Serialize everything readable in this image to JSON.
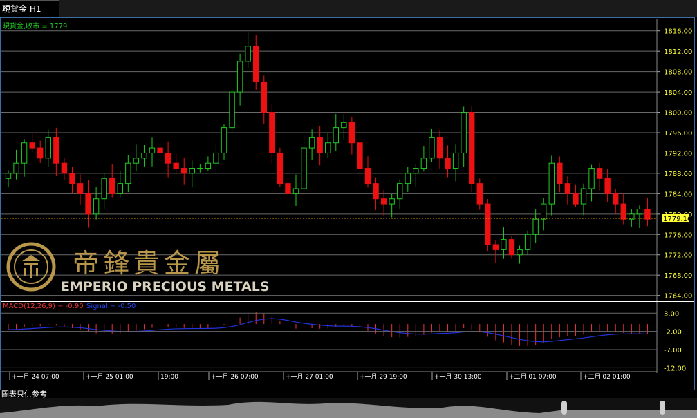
{
  "tab": {
    "title": "現貨金 H1",
    "close": "×"
  },
  "series_label": "現貨金,收市 = 1779",
  "macd_label": "MACD(12,26,9) = -0.90",
  "signal_label": "Signal = -0.50",
  "price_tag": "1779.16",
  "footer_note": "圖表只供參考",
  "watermark": {
    "chinese": "帝鋒貴金屬",
    "english": "EMPERIO PRECIOUS METALS"
  },
  "colors": {
    "up": "#22cc22",
    "down": "#ee1111",
    "axis_text": "#ffff33",
    "signal": "#2222ee",
    "macd": "#ee3333",
    "price_line": "#cc8800"
  },
  "chart_data": {
    "type": "candlestick",
    "title": "現貨金 H1",
    "y_ticks": [
      "1816.00",
      "1812.00",
      "1808.00",
      "1804.00",
      "1800.00",
      "1796.00",
      "1792.00",
      "1788.00",
      "1784.00",
      "1780.00",
      "1776.00",
      "1772.00",
      "1768.00",
      "1764.00"
    ],
    "y_range": [
      1763,
      1818
    ],
    "last_price": 1779.16,
    "x_ticks": [
      "一月 24 07:00",
      "一月 25 01:00",
      "19:00",
      "一月 26 07:00",
      "一月 27 01:00",
      "一月 29 19:00",
      "一月 30 13:00",
      "二月 01 07:00",
      "二月 02 01:00"
    ],
    "macd_ticks": [
      "3.00",
      "-2.00",
      "-7.00",
      "-12.00"
    ],
    "macd_range": [
      -12.5,
      4
    ],
    "close": [
      1788,
      1790,
      1794,
      1793,
      1791,
      1795,
      1790,
      1788,
      1786,
      1784,
      1780,
      1783,
      1787,
      1784,
      1786,
      1790,
      1791,
      1792,
      1793,
      1792,
      1790,
      1789,
      1788,
      1789,
      1789,
      1790,
      1792,
      1797,
      1804,
      1810,
      1813,
      1806,
      1800,
      1792,
      1786,
      1784,
      1785,
      1793,
      1795,
      1792,
      1794,
      1797,
      1798,
      1794,
      1789,
      1786,
      1783,
      1782,
      1783,
      1786,
      1788,
      1789,
      1791,
      1795,
      1791,
      1789,
      1792,
      1800,
      1786,
      1782,
      1774,
      1773,
      1775,
      1772,
      1773,
      1776,
      1779,
      1782,
      1790,
      1786,
      1784,
      1782,
      1785,
      1789,
      1787,
      1784,
      1782,
      1779,
      1780,
      1781,
      1779
    ]
  }
}
